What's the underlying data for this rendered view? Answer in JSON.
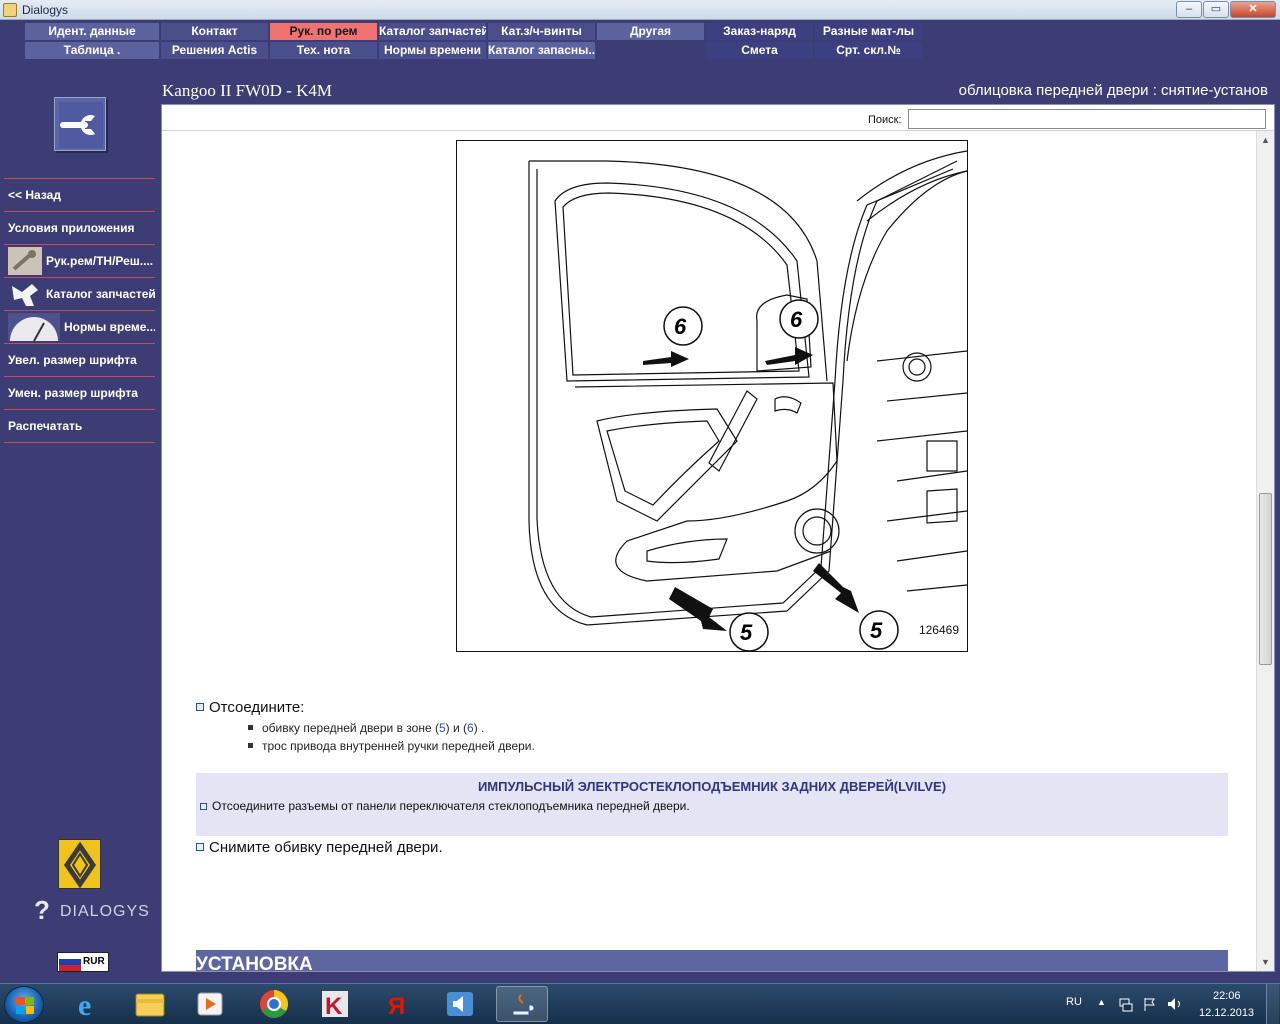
{
  "window": {
    "title": "Dialogys"
  },
  "menu": {
    "row1": [
      "Идент. данные",
      "Контакт",
      "Рук. по рем",
      "Каталог запчастей",
      "Кат.з/ч-винты",
      "Другая",
      "Заказ-наряд",
      "Разные мат-лы"
    ],
    "row2": [
      "Таблица .",
      "Решения Actis",
      "Тех. нота",
      "Нормы времени",
      "Каталог запасны...",
      "Смета",
      "Срт. скл.№"
    ]
  },
  "header": {
    "vehicle": "Kangoo II FW0D - K4M",
    "operation": "облицовка передней двери : снятие-установ"
  },
  "sidebar": {
    "items": [
      {
        "label": "<< Назад"
      },
      {
        "label": "Условия приложения"
      },
      {
        "label": "Рук.рем/TH/Реш....",
        "icon": "wrench-icon"
      },
      {
        "label": "Каталог запчастей",
        "icon": "parts-icon"
      },
      {
        "label": "Нормы време...",
        "icon": "clock-icon"
      },
      {
        "label": "Увел. размер шрифта"
      },
      {
        "label": "Умен. размер шрифта"
      },
      {
        "label": "Распечатать"
      }
    ],
    "brand": "DIALOGYS",
    "currency": "RUR"
  },
  "search": {
    "label": "Поиск:",
    "value": ""
  },
  "figure": {
    "number": "126469",
    "callouts": [
      "6",
      "6",
      "5",
      "5"
    ]
  },
  "steps": {
    "disconnect_title": "Отсоедините:",
    "sub1_pre": "обивку передней двери в зоне (",
    "sub1_ref1": "5",
    "sub1_mid": ") и (",
    "sub1_ref2": "6",
    "sub1_post": ") .",
    "sub2": "трос привода внутренней ручки передней двери.",
    "note_title": "ИМПУЛЬСНЫЙ ЭЛЕКТРОСТЕКЛОПОДЪЕМНИК ЗАДНИХ ДВЕРЕЙ(LVILVE)",
    "note_text": "Отсоедините разъемы от панели переключателя стеклоподъемника передней двери.",
    "remove": "Снимите обивку передней двери.",
    "install_heading": "УСТАНОВКА"
  },
  "taskbar": {
    "lang": "RU",
    "time": "22:06",
    "date": "12.12.2013"
  }
}
